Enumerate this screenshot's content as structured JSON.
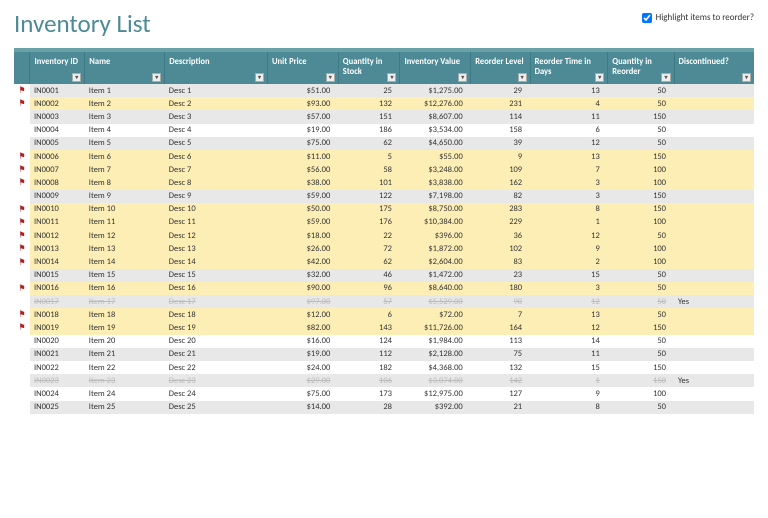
{
  "title": "Inventory List",
  "highlight_label": "Highlight items to reorder?",
  "highlight_checked": true,
  "columns": [
    "Inventory ID",
    "Name",
    "Description",
    "Unit Price",
    "Quantity in Stock",
    "Inventory Value",
    "Reorder Level",
    "Reorder Time in Days",
    "Quantity in Reorder",
    "Discontinued?"
  ],
  "rows": [
    {
      "flag": true,
      "id": "IN0001",
      "name": "Item 1",
      "desc": "Desc 1",
      "price": "$51.00",
      "qstock": 25,
      "ival": "$1,275.00",
      "rlvl": 29,
      "rtime": 13,
      "qreo": 50,
      "disc": "",
      "hl": false
    },
    {
      "flag": true,
      "id": "IN0002",
      "name": "Item 2",
      "desc": "Desc 2",
      "price": "$93.00",
      "qstock": 132,
      "ival": "$12,276.00",
      "rlvl": 231,
      "rtime": 4,
      "qreo": 50,
      "disc": "",
      "hl": true
    },
    {
      "flag": false,
      "id": "IN0003",
      "name": "Item 3",
      "desc": "Desc 3",
      "price": "$57.00",
      "qstock": 151,
      "ival": "$8,607.00",
      "rlvl": 114,
      "rtime": 11,
      "qreo": 150,
      "disc": "",
      "hl": false
    },
    {
      "flag": false,
      "id": "IN0004",
      "name": "Item 4",
      "desc": "Desc 4",
      "price": "$19.00",
      "qstock": 186,
      "ival": "$3,534.00",
      "rlvl": 158,
      "rtime": 6,
      "qreo": 50,
      "disc": "",
      "hl": false
    },
    {
      "flag": false,
      "id": "IN0005",
      "name": "Item 5",
      "desc": "Desc 5",
      "price": "$75.00",
      "qstock": 62,
      "ival": "$4,650.00",
      "rlvl": 39,
      "rtime": 12,
      "qreo": 50,
      "disc": "",
      "hl": false
    },
    {
      "flag": true,
      "id": "IN0006",
      "name": "Item 6",
      "desc": "Desc 6",
      "price": "$11.00",
      "qstock": 5,
      "ival": "$55.00",
      "rlvl": 9,
      "rtime": 13,
      "qreo": 150,
      "disc": "",
      "hl": true
    },
    {
      "flag": true,
      "id": "IN0007",
      "name": "Item 7",
      "desc": "Desc 7",
      "price": "$56.00",
      "qstock": 58,
      "ival": "$3,248.00",
      "rlvl": 109,
      "rtime": 7,
      "qreo": 100,
      "disc": "",
      "hl": true
    },
    {
      "flag": true,
      "id": "IN0008",
      "name": "Item 8",
      "desc": "Desc 8",
      "price": "$38.00",
      "qstock": 101,
      "ival": "$3,838.00",
      "rlvl": 162,
      "rtime": 3,
      "qreo": 100,
      "disc": "",
      "hl": true
    },
    {
      "flag": false,
      "id": "IN0009",
      "name": "Item 9",
      "desc": "Desc 9",
      "price": "$59.00",
      "qstock": 122,
      "ival": "$7,198.00",
      "rlvl": 82,
      "rtime": 3,
      "qreo": 150,
      "disc": "",
      "hl": false
    },
    {
      "flag": true,
      "id": "IN0010",
      "name": "Item 10",
      "desc": "Desc 10",
      "price": "$50.00",
      "qstock": 175,
      "ival": "$8,750.00",
      "rlvl": 283,
      "rtime": 8,
      "qreo": 150,
      "disc": "",
      "hl": true
    },
    {
      "flag": true,
      "id": "IN0011",
      "name": "Item 11",
      "desc": "Desc 11",
      "price": "$59.00",
      "qstock": 176,
      "ival": "$10,384.00",
      "rlvl": 229,
      "rtime": 1,
      "qreo": 100,
      "disc": "",
      "hl": true
    },
    {
      "flag": true,
      "id": "IN0012",
      "name": "Item 12",
      "desc": "Desc 12",
      "price": "$18.00",
      "qstock": 22,
      "ival": "$396.00",
      "rlvl": 36,
      "rtime": 12,
      "qreo": 50,
      "disc": "",
      "hl": true
    },
    {
      "flag": true,
      "id": "IN0013",
      "name": "Item 13",
      "desc": "Desc 13",
      "price": "$26.00",
      "qstock": 72,
      "ival": "$1,872.00",
      "rlvl": 102,
      "rtime": 9,
      "qreo": 100,
      "disc": "",
      "hl": true
    },
    {
      "flag": true,
      "id": "IN0014",
      "name": "Item 14",
      "desc": "Desc 14",
      "price": "$42.00",
      "qstock": 62,
      "ival": "$2,604.00",
      "rlvl": 83,
      "rtime": 2,
      "qreo": 100,
      "disc": "",
      "hl": true
    },
    {
      "flag": false,
      "id": "IN0015",
      "name": "Item 15",
      "desc": "Desc 15",
      "price": "$32.00",
      "qstock": 46,
      "ival": "$1,472.00",
      "rlvl": 23,
      "rtime": 15,
      "qreo": 50,
      "disc": "",
      "hl": false
    },
    {
      "flag": true,
      "id": "IN0016",
      "name": "Item 16",
      "desc": "Desc 16",
      "price": "$90.00",
      "qstock": 96,
      "ival": "$8,640.00",
      "rlvl": 180,
      "rtime": 3,
      "qreo": 50,
      "disc": "",
      "hl": true
    },
    {
      "flag": false,
      "id": "IN0017",
      "name": "Item 17",
      "desc": "Desc 17",
      "price": "$97.00",
      "qstock": 57,
      "ival": "$5,529.00",
      "rlvl": 98,
      "rtime": 12,
      "qreo": 50,
      "disc": "Yes",
      "hl": false,
      "discontinued": true
    },
    {
      "flag": true,
      "id": "IN0018",
      "name": "Item 18",
      "desc": "Desc 18",
      "price": "$12.00",
      "qstock": 6,
      "ival": "$72.00",
      "rlvl": 7,
      "rtime": 13,
      "qreo": 50,
      "disc": "",
      "hl": true
    },
    {
      "flag": true,
      "id": "IN0019",
      "name": "Item 19",
      "desc": "Desc 19",
      "price": "$82.00",
      "qstock": 143,
      "ival": "$11,726.00",
      "rlvl": 164,
      "rtime": 12,
      "qreo": 150,
      "disc": "",
      "hl": true
    },
    {
      "flag": false,
      "id": "IN0020",
      "name": "Item 20",
      "desc": "Desc 20",
      "price": "$16.00",
      "qstock": 124,
      "ival": "$1,984.00",
      "rlvl": 113,
      "rtime": 14,
      "qreo": 50,
      "disc": "",
      "hl": false
    },
    {
      "flag": false,
      "id": "IN0021",
      "name": "Item 21",
      "desc": "Desc 21",
      "price": "$19.00",
      "qstock": 112,
      "ival": "$2,128.00",
      "rlvl": 75,
      "rtime": 11,
      "qreo": 50,
      "disc": "",
      "hl": false
    },
    {
      "flag": false,
      "id": "IN0022",
      "name": "Item 22",
      "desc": "Desc 22",
      "price": "$24.00",
      "qstock": 182,
      "ival": "$4,368.00",
      "rlvl": 132,
      "rtime": 15,
      "qreo": 150,
      "disc": "",
      "hl": false
    },
    {
      "flag": false,
      "id": "IN0023",
      "name": "Item 23",
      "desc": "Desc 23",
      "price": "$29.00",
      "qstock": 106,
      "ival": "$3,074.00",
      "rlvl": 142,
      "rtime": 1,
      "qreo": 150,
      "disc": "Yes",
      "hl": false,
      "discontinued": true
    },
    {
      "flag": false,
      "id": "IN0024",
      "name": "Item 24",
      "desc": "Desc 24",
      "price": "$75.00",
      "qstock": 173,
      "ival": "$12,975.00",
      "rlvl": 127,
      "rtime": 9,
      "qreo": 100,
      "disc": "",
      "hl": false
    },
    {
      "flag": false,
      "id": "IN0025",
      "name": "Item 25",
      "desc": "Desc 25",
      "price": "$14.00",
      "qstock": 28,
      "ival": "$392.00",
      "rlvl": 21,
      "rtime": 8,
      "qreo": 50,
      "disc": "",
      "hl": false
    }
  ]
}
